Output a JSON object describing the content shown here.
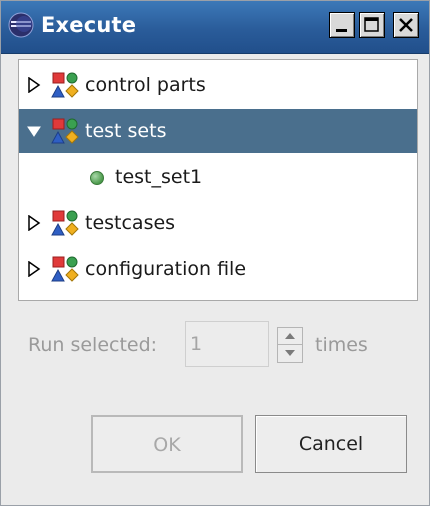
{
  "window": {
    "title": "Execute",
    "controls": [
      "minimize-icon",
      "maximize-icon",
      "close-icon"
    ]
  },
  "tree": {
    "items": [
      {
        "label": "control parts",
        "expanded": false,
        "selected": false
      },
      {
        "label": "test sets",
        "expanded": true,
        "selected": true,
        "children": [
          {
            "label": "test_set1"
          }
        ]
      },
      {
        "label": "testcases",
        "expanded": false,
        "selected": false
      },
      {
        "label": "configuration file",
        "expanded": false,
        "selected": false
      }
    ]
  },
  "run": {
    "label": "Run selected:",
    "value": "1",
    "suffix": "times"
  },
  "buttons": {
    "ok": "OK",
    "cancel": "Cancel"
  },
  "colors": {
    "selection": "#4a6f8d",
    "title_bar": "#2a5c9a"
  }
}
